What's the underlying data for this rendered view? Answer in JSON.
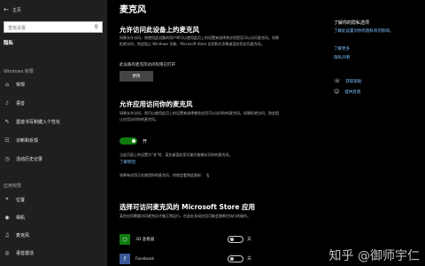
{
  "sidebar": {
    "back_glyph": "←",
    "home_label": "主页",
    "search_placeholder": "查找设置",
    "search_glyph": "⚲",
    "heading": "隐私",
    "section_windows": "Windows 权限",
    "windows_items": [
      {
        "icon": "general-icon",
        "glyph": "⌂",
        "label": "常规"
      },
      {
        "icon": "speech-icon",
        "glyph": "♪",
        "label": "语音"
      },
      {
        "icon": "inking-icon",
        "glyph": "✎",
        "label": "墨迹书写和键入个性化"
      },
      {
        "icon": "diagnostics-icon",
        "glyph": "☷",
        "label": "诊断和反馈"
      },
      {
        "icon": "activity-icon",
        "glyph": "◷",
        "label": "活动历史记录"
      }
    ],
    "section_app": "应用权限",
    "app_items": [
      {
        "icon": "location-icon",
        "glyph": "⌖",
        "label": "位置"
      },
      {
        "icon": "camera-icon",
        "glyph": "◉",
        "label": "相机"
      },
      {
        "icon": "microphone-icon",
        "glyph": "♫",
        "label": "麦克风"
      },
      {
        "icon": "voice-activation-icon",
        "glyph": "◎",
        "label": "语音激活"
      }
    ]
  },
  "main": {
    "title": "麦克风",
    "section1_title": "允许访问此设备上的麦克风",
    "section1_text": "如果允许访问，则使用此设备的用户将可以使用此页上的设置来选择其应用是否可以访问麦克风。如果拒绝访问，则会阻止 Windows 功能、Microsoft Store 应用和大多数桌面应用访问麦克风。",
    "device_status": "此设备的麦克风访问权限已打开",
    "change_button": "更改",
    "section2_title": "允许应用访问你的麦克风",
    "section2_text": "如果允许访问，则可以使用此页上的设置来选择哪些应用可以访问你的麦克风。如果拒绝访问，则会阻止应用访问你的麦克风。",
    "toggle_state": "开",
    "section2_note": "当此页面上的设置为\"关\"时，某些桌面应用可能仍能够访问你的麦克风。",
    "learn_more": "了解原因",
    "recent_note": "如果有应用正在使用你的麦克风，你就会看到此图标：",
    "section3_title": "选择可访问麦克风的 Microsoft Store 应用",
    "section3_text": "某些应用需要访问麦克风才能正常运行。在此处关闭应用可能会限制它执行的操作。",
    "apps": [
      {
        "icon": "3d-viewer-icon",
        "glyph": "⬡",
        "name": "3D 查看器",
        "state": "关",
        "color": "#107c10"
      },
      {
        "icon": "facebook-icon",
        "glyph": "f",
        "name": "Facebook",
        "state": "关",
        "color": "#3b5998"
      }
    ]
  },
  "right": {
    "title": "了解你的隐私选项",
    "links": [
      "了解此设置对你的隐私有何影响。",
      "了解更多",
      "隐私声明"
    ],
    "help_items": [
      {
        "icon": "help-icon",
        "glyph": "☏",
        "label": "获取帮助"
      },
      {
        "icon": "feedback-icon",
        "glyph": "☺",
        "label": "提供反馈"
      }
    ]
  },
  "watermark": "知乎 @御师宇仁"
}
